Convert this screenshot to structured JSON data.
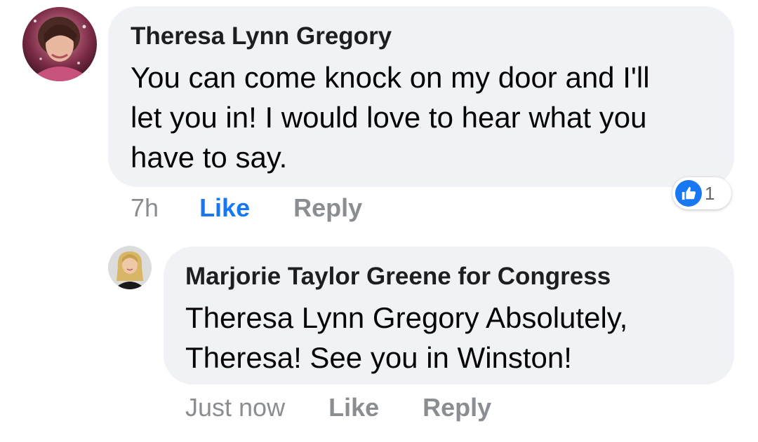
{
  "comments": [
    {
      "author": "Theresa Lynn Gregory",
      "avatar_icon": "profile-photo",
      "lines": [
        "You can come knock on my door and I'll",
        "let you in! I would love to hear what you",
        "have to say."
      ],
      "time": "7h",
      "like_label": "Like",
      "reply_label": "Reply",
      "reaction": {
        "icon": "thumbs-up-icon",
        "count": "1"
      }
    },
    {
      "author": "Marjorie Taylor Greene for Congress",
      "avatar_icon": "profile-photo",
      "lines": [
        "Theresa Lynn Gregory Absolutely,",
        "Theresa! See you in Winston!"
      ],
      "time": "Just now",
      "like_label": "Like",
      "reply_label": "Reply"
    }
  ],
  "colors": {
    "bubble": "#f0f2f5",
    "link_blue": "#1877f2",
    "muted": "#8a8d91"
  }
}
